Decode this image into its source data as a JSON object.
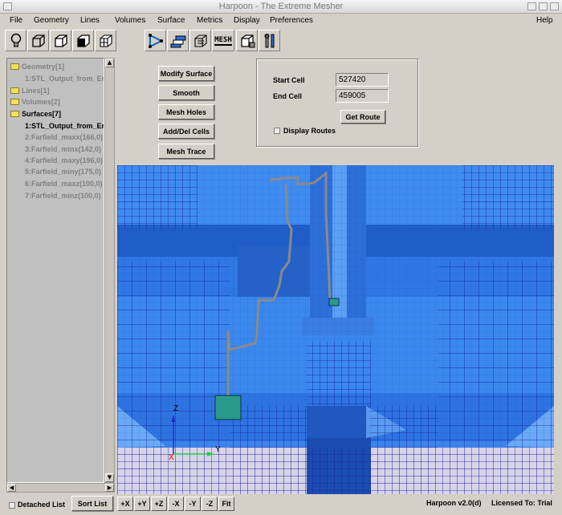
{
  "window": {
    "title": "Harpoon - The Extreme Mesher"
  },
  "menu": [
    "File",
    "Geometry",
    "Lines",
    "Volumes",
    "Surface",
    "Metrics",
    "Display",
    "Preferences",
    "Help"
  ],
  "toolbar_icons": [
    "lightbulb-icon",
    "cube-icon",
    "cube-icon",
    "cube-icon",
    "cube-icon",
    "triangle-mesh-icon",
    "layers-icon",
    "cube-wire-icon",
    "mesh-text-icon",
    "cube-stack-icon",
    "tools-icon"
  ],
  "toolbar_mesh_label": "MESH",
  "tree": {
    "items": [
      {
        "label": "Geometry[1]",
        "folder": true,
        "grey": true
      },
      {
        "label": "1:STL_Output_from_Er",
        "folder": false,
        "grey": true
      },
      {
        "label": "Lines[1]",
        "folder": true,
        "grey": true
      },
      {
        "label": "Volumes[2]",
        "folder": true,
        "grey": true
      },
      {
        "label": "Surfaces[7]",
        "folder": true,
        "grey": false
      },
      {
        "label": "1:STL_Output_from_Er",
        "folder": false,
        "grey": false
      },
      {
        "label": "2:Farfield_maxx(166,0)",
        "folder": false,
        "grey": true
      },
      {
        "label": "3:Farfield_minx(142,0)",
        "folder": false,
        "grey": true
      },
      {
        "label": "4:Farfield_maxy(196,0)",
        "folder": false,
        "grey": true
      },
      {
        "label": "5:Farfield_miny(175,0)",
        "folder": false,
        "grey": true
      },
      {
        "label": "6:Farfield_maxz(100,0)",
        "folder": false,
        "grey": true
      },
      {
        "label": "7:Farfield_minz(100,0)",
        "folder": false,
        "grey": true
      }
    ]
  },
  "actions": {
    "modify_surface": "Modify Surface",
    "smooth": "Smooth",
    "mesh_holes": "Mesh Holes",
    "add_del_cells": "Add/Del Cells",
    "mesh_trace": "Mesh Trace"
  },
  "route": {
    "start_label": "Start Cell",
    "start_value": "527420",
    "end_label": "End Cell",
    "end_value": "459005",
    "get_route": "Get Route",
    "display_routes": "Display Routes"
  },
  "axes": {
    "z": "Z",
    "y": "Y",
    "x": "X"
  },
  "bottom": {
    "detached_list": "Detached List",
    "sort_list": "Sort List",
    "view_buttons": [
      "+X",
      "+Y",
      "+Z",
      "-X",
      "-Y",
      "-Z",
      "Fit"
    ],
    "version": "Harpoon v2.0(d)",
    "license": "Licensed To: Trial"
  },
  "colors": {
    "mesh_blue": "#2a73e0",
    "grid_line": "#1a1aa0",
    "route_line": "#8a8a8a",
    "cell_teal": "#2a9a8a"
  }
}
